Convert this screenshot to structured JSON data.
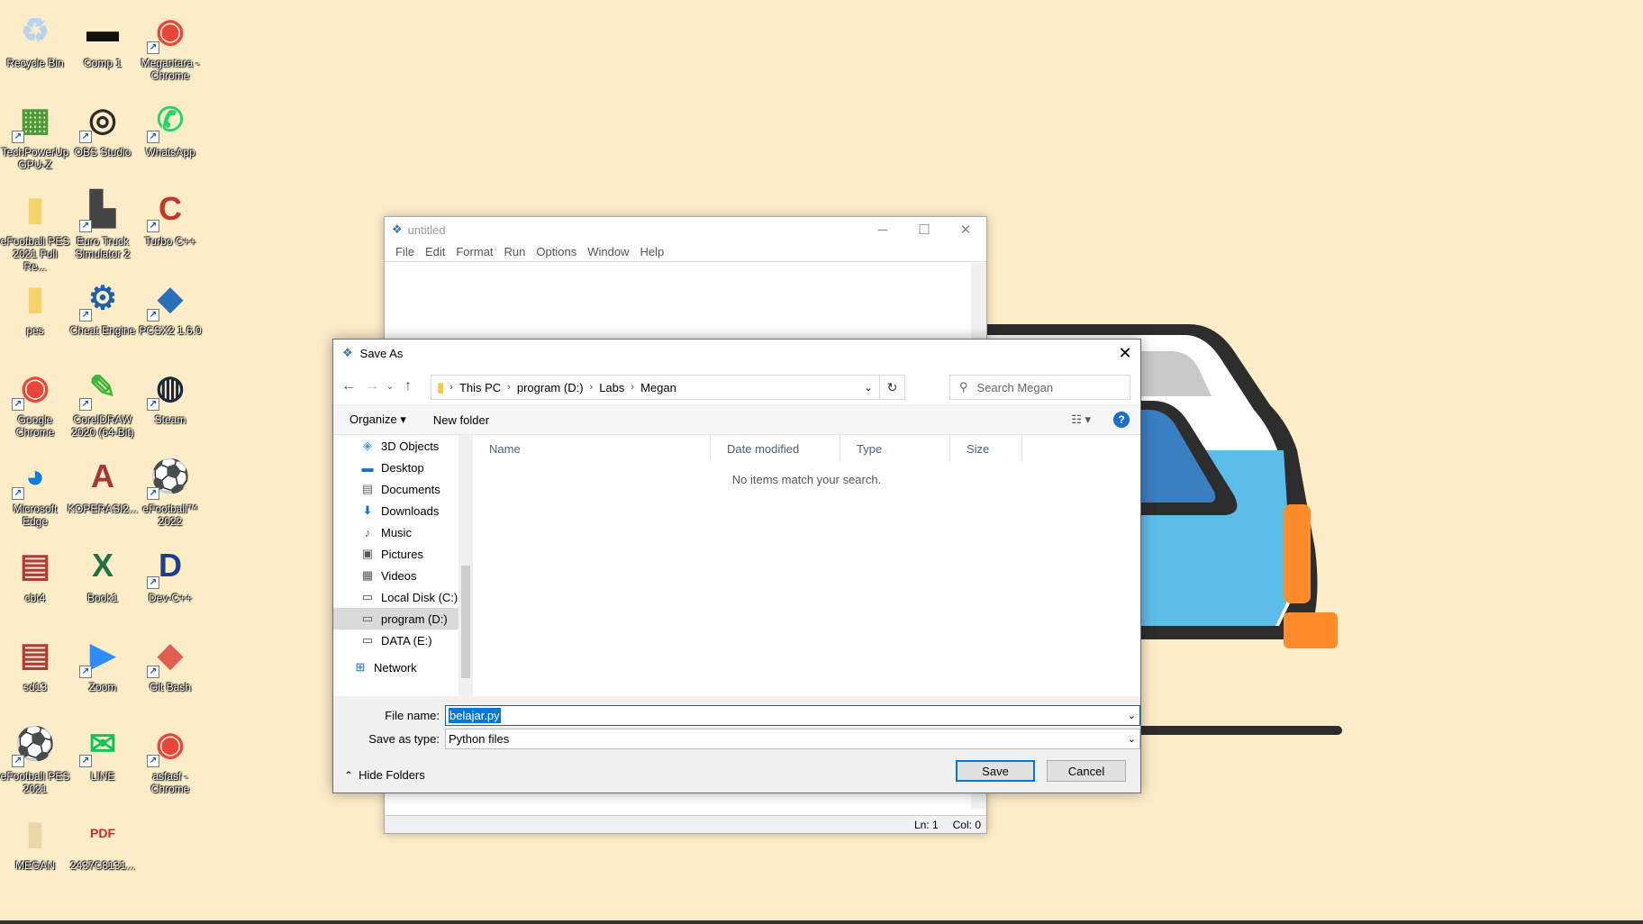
{
  "desktop": {
    "icons": [
      {
        "label": "Recycle Bin",
        "icon": "recycle-bin-icon",
        "glyph": "♻",
        "color": "#b8d4ef",
        "shortcut": false
      },
      {
        "label": "Comp 1",
        "icon": "video-file-icon",
        "glyph": "▬",
        "color": "#111111",
        "shortcut": false
      },
      {
        "label": "Megantara - Chrome",
        "icon": "chrome-profile-icon",
        "glyph": "◉",
        "color": "#e8453c",
        "shortcut": true
      },
      {
        "label": "TechPowerUp GPU-Z",
        "icon": "gpu-z-icon",
        "glyph": "▦",
        "color": "#4a9c3b",
        "shortcut": true
      },
      {
        "label": "OBS Studio",
        "icon": "obs-icon",
        "glyph": "◎",
        "color": "#2a2a2a",
        "shortcut": true
      },
      {
        "label": "WhatsApp",
        "icon": "whatsapp-icon",
        "glyph": "✆",
        "color": "#25d366",
        "shortcut": true
      },
      {
        "label": "eFootball PES 2021 Full Re...",
        "icon": "folder-icon",
        "glyph": "▮",
        "color": "#f5d36b",
        "shortcut": false
      },
      {
        "label": "Euro Truck Simulator 2",
        "icon": "truck-icon",
        "glyph": "▙",
        "color": "#444444",
        "shortcut": true
      },
      {
        "label": "Turbo C++",
        "icon": "turbo-cpp-icon",
        "glyph": "C",
        "color": "#c0392b",
        "shortcut": true
      },
      {
        "label": "pes",
        "icon": "folder-icon",
        "glyph": "▮",
        "color": "#f5d36b",
        "shortcut": false
      },
      {
        "label": "Cheat Engine",
        "icon": "cheat-engine-icon",
        "glyph": "⚙",
        "color": "#1e5fa8",
        "shortcut": true
      },
      {
        "label": "PCSX2 1.6.0",
        "icon": "pcsx2-icon",
        "glyph": "◆",
        "color": "#2a6fb8",
        "shortcut": true
      },
      {
        "label": "Google Chrome",
        "icon": "chrome-icon",
        "glyph": "◉",
        "color": "#e8453c",
        "shortcut": true
      },
      {
        "label": "CorelDRAW 2020 (64-Bit)",
        "icon": "coreldraw-icon",
        "glyph": "✎",
        "color": "#3cb43c",
        "shortcut": true
      },
      {
        "label": "Steam",
        "icon": "steam-icon",
        "glyph": "◍",
        "color": "#1b2838",
        "shortcut": true
      },
      {
        "label": "Microsoft Edge",
        "icon": "edge-icon",
        "glyph": "◕",
        "color": "#0f7fd6",
        "shortcut": true
      },
      {
        "label": "KOPERASI2...",
        "icon": "access-file-icon",
        "glyph": "A",
        "color": "#a4373a",
        "shortcut": false
      },
      {
        "label": "eFootball™ 2022",
        "icon": "efootball-icon",
        "glyph": "⚽",
        "color": "#1a2a6b",
        "shortcut": true
      },
      {
        "label": "cbt4",
        "icon": "archive-icon",
        "glyph": "▤",
        "color": "#b03a3a",
        "shortcut": false
      },
      {
        "label": "Book1",
        "icon": "excel-file-icon",
        "glyph": "X",
        "color": "#1f7244",
        "shortcut": false
      },
      {
        "label": "Dev-C++",
        "icon": "devcpp-icon",
        "glyph": "D",
        "color": "#1c3f8c",
        "shortcut": true
      },
      {
        "label": "sd13",
        "icon": "archive-icon",
        "glyph": "▤",
        "color": "#b03a3a",
        "shortcut": false
      },
      {
        "label": "Zoom",
        "icon": "zoom-icon",
        "glyph": "▶",
        "color": "#2d8cff",
        "shortcut": true
      },
      {
        "label": "Git Bash",
        "icon": "git-bash-icon",
        "glyph": "◆",
        "color": "#e35d4f",
        "shortcut": true
      },
      {
        "label": "eFootball PES 2021",
        "icon": "pes-icon",
        "glyph": "⚽",
        "color": "#1a2a6b",
        "shortcut": true
      },
      {
        "label": "LINE",
        "icon": "line-icon",
        "glyph": "✉",
        "color": "#06c755",
        "shortcut": true
      },
      {
        "label": "asfasf - Chrome",
        "icon": "chrome-profile-icon",
        "glyph": "◉",
        "color": "#e8453c",
        "shortcut": true
      },
      {
        "label": "MEGAN",
        "icon": "folder-icon",
        "glyph": "▮",
        "color": "#e9d8a6",
        "shortcut": false
      },
      {
        "label": "2437C8131...",
        "icon": "pdf-icon",
        "glyph": "PDF",
        "color": "#d8262a",
        "shortcut": false
      }
    ]
  },
  "idle": {
    "title": "untitled",
    "menu": [
      "File",
      "Edit",
      "Format",
      "Run",
      "Options",
      "Window",
      "Help"
    ],
    "status_ln": "Ln: 1",
    "status_col": "Col: 0"
  },
  "dialog": {
    "title": "Save As",
    "close": "✕",
    "breadcrumb": [
      "This PC",
      "program (D:)",
      "Labs",
      "Megan"
    ],
    "search_placeholder": "Search Megan",
    "organize": "Organize ▾",
    "new_folder": "New folder",
    "help": "?",
    "tree": [
      {
        "label": "3D Objects",
        "icon": "3d-objects-icon",
        "glyph": "◈",
        "selected": false
      },
      {
        "label": "Desktop",
        "icon": "desktop-icon",
        "glyph": "▬",
        "selected": false
      },
      {
        "label": "Documents",
        "icon": "documents-icon",
        "glyph": "▤",
        "selected": false
      },
      {
        "label": "Downloads",
        "icon": "downloads-icon",
        "glyph": "⬇",
        "selected": false
      },
      {
        "label": "Music",
        "icon": "music-icon",
        "glyph": "♪",
        "selected": false
      },
      {
        "label": "Pictures",
        "icon": "pictures-icon",
        "glyph": "▣",
        "selected": false
      },
      {
        "label": "Videos",
        "icon": "videos-icon",
        "glyph": "▦",
        "selected": false
      },
      {
        "label": "Local Disk (C:)",
        "icon": "drive-icon",
        "glyph": "▭",
        "selected": false
      },
      {
        "label": "program (D:)",
        "icon": "drive-icon",
        "glyph": "▭",
        "selected": true
      },
      {
        "label": "DATA (E:)",
        "icon": "drive-icon",
        "glyph": "▭",
        "selected": false
      },
      {
        "label": "Network",
        "icon": "network-icon",
        "glyph": "⊞",
        "selected": false
      }
    ],
    "columns": [
      "Name",
      "Date modified",
      "Type",
      "Size"
    ],
    "empty_message": "No items match your search.",
    "file_name_label": "File name:",
    "file_name_value": "belajar.py",
    "save_type_label": "Save as type:",
    "save_type_value": "Python files",
    "hide_folders": "Hide Folders",
    "save_button": "Save",
    "cancel_button": "Cancel"
  },
  "colors": {
    "desktop_bg": "#fdecc8",
    "accent": "#0078d7"
  }
}
